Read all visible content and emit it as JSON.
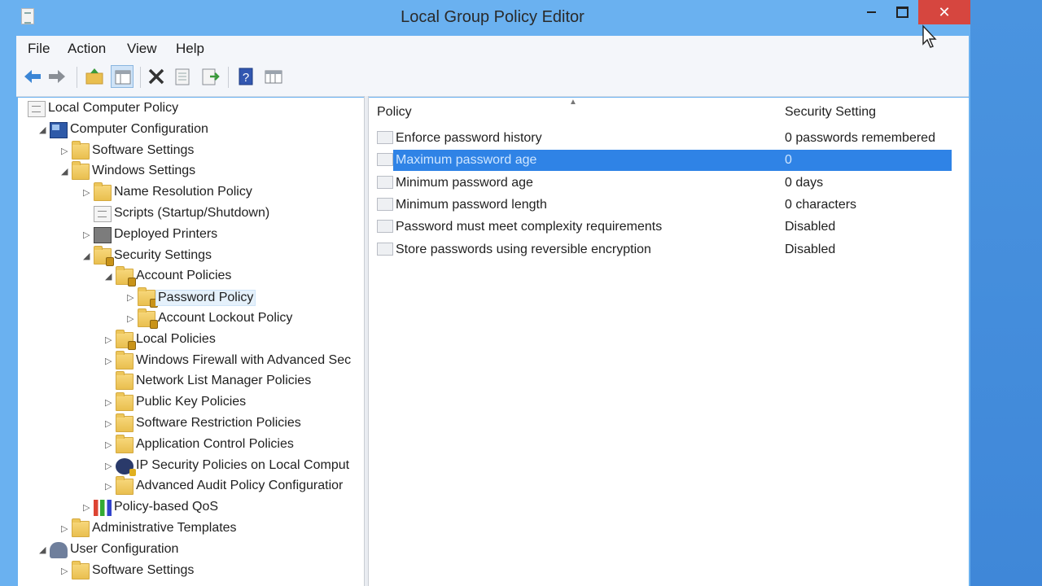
{
  "window": {
    "title": "Local Group Policy Editor",
    "close_glyph": "✕"
  },
  "menu": [
    "File",
    "Action",
    "View",
    "Help"
  ],
  "toolbar_icons": [
    "back-arrow-icon",
    "forward-arrow-icon",
    "up-folder-icon",
    "show-hide-tree-icon",
    "delete-icon",
    "properties-icon",
    "export-list-icon",
    "help-icon",
    "console-icon"
  ],
  "tree": [
    {
      "label": "Local Computer Policy",
      "level": 0,
      "arrow": "",
      "icon": "doc"
    },
    {
      "label": "Computer Configuration",
      "level": 1,
      "arrow": "◢",
      "icon": "pc"
    },
    {
      "label": "Software Settings",
      "level": 2,
      "arrow": "▷",
      "icon": "folder"
    },
    {
      "label": "Windows Settings",
      "level": 2,
      "arrow": "◢",
      "icon": "folder"
    },
    {
      "label": "Name Resolution Policy",
      "level": 3,
      "arrow": "▷",
      "icon": "folder"
    },
    {
      "label": "Scripts (Startup/Shutdown)",
      "level": 3,
      "arrow": "",
      "icon": "doc"
    },
    {
      "label": "Deployed Printers",
      "level": 3,
      "arrow": "▷",
      "icon": "printer"
    },
    {
      "label": "Security Settings",
      "level": 3,
      "arrow": "◢",
      "icon": "folder-lock"
    },
    {
      "label": "Account Policies",
      "level": 4,
      "arrow": "◢",
      "icon": "folder-lock"
    },
    {
      "label": "Password Policy",
      "level": 5,
      "arrow": "▷",
      "icon": "folder-lock",
      "selected": true
    },
    {
      "label": "Account Lockout Policy",
      "level": 5,
      "arrow": "▷",
      "icon": "folder-lock"
    },
    {
      "label": "Local Policies",
      "level": 4,
      "arrow": "▷",
      "icon": "folder-lock"
    },
    {
      "label": "Windows Firewall with Advanced Sec",
      "level": 4,
      "arrow": "▷",
      "icon": "folder"
    },
    {
      "label": "Network List Manager Policies",
      "level": 4,
      "arrow": "",
      "icon": "folder"
    },
    {
      "label": "Public Key Policies",
      "level": 4,
      "arrow": "▷",
      "icon": "folder"
    },
    {
      "label": "Software Restriction Policies",
      "level": 4,
      "arrow": "▷",
      "icon": "folder"
    },
    {
      "label": "Application Control Policies",
      "level": 4,
      "arrow": "▷",
      "icon": "folder"
    },
    {
      "label": "IP Security Policies on Local Comput",
      "level": 4,
      "arrow": "▷",
      "icon": "ipsec"
    },
    {
      "label": "Advanced Audit Policy Configuratior",
      "level": 4,
      "arrow": "▷",
      "icon": "folder"
    },
    {
      "label": "Policy-based QoS",
      "level": 3,
      "arrow": "▷",
      "icon": "qos"
    },
    {
      "label": "Administrative Templates",
      "level": 2,
      "arrow": "▷",
      "icon": "folder"
    },
    {
      "label": "User Configuration",
      "level": 1,
      "arrow": "◢",
      "icon": "user"
    },
    {
      "label": "Software Settings",
      "level": 2,
      "arrow": "▷",
      "icon": "folder"
    }
  ],
  "policy_table": {
    "columns": [
      "Policy",
      "Security Setting"
    ],
    "sort_indicator": "▲",
    "rows": [
      {
        "policy": "Enforce password history",
        "setting": "0 passwords remembered"
      },
      {
        "policy": "Maximum password age",
        "setting": "0",
        "selected": true
      },
      {
        "policy": "Minimum password age",
        "setting": "0 days"
      },
      {
        "policy": "Minimum password length",
        "setting": "0 characters"
      },
      {
        "policy": "Password must meet complexity requirements",
        "setting": "Disabled"
      },
      {
        "policy": "Store passwords using reversible encryption",
        "setting": "Disabled"
      }
    ]
  },
  "colors": {
    "titlebar": "#6ab1f0",
    "close_button": "#d6463f",
    "selection": "#2f83e6"
  }
}
